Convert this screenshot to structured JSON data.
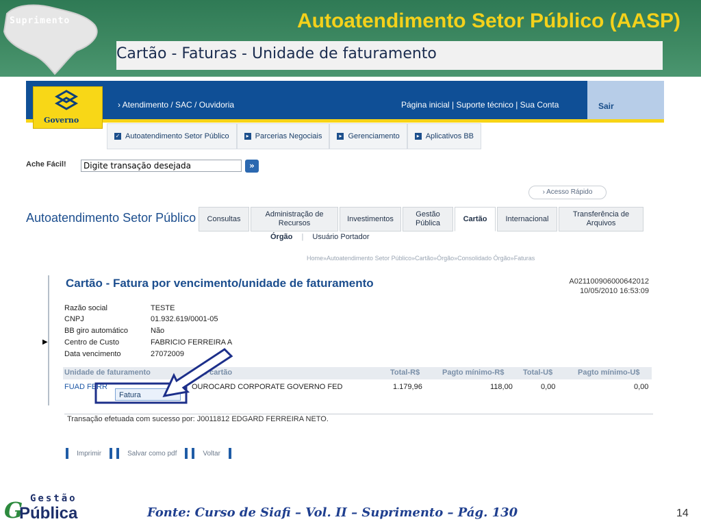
{
  "slide": {
    "title": "Autoatendimento Setor Público (AASP)",
    "subtitle": "Cartão  - Faturas - Unidade de faturamento",
    "logo_text": "Suprimento",
    "source": "Fonte: Curso de Siafi – Vol. II – Suprimento – Pág. 130",
    "page_number": "14",
    "footer_logo_small": "Gestão",
    "footer_logo_big": "Pública"
  },
  "header": {
    "bank_label": "Governo",
    "link_atendimento": "› Atendimento / SAC / Ouvidoria",
    "link_pagina_inicial": "Página inicial  |  Suporte técnico  |  Sua Conta",
    "sair": "Sair"
  },
  "nav_tabs": [
    "Autoatendimento Setor Público",
    "Parcerias Negociais",
    "Gerenciamento",
    "Aplicativos BB"
  ],
  "search": {
    "label": "Ache Fácil!",
    "value": "Digite transação desejada",
    "button": "»"
  },
  "acesso_rapido": "› Acesso Rápido",
  "aasp": {
    "title": "Autoatendimento Setor Público",
    "tabs": [
      "Consultas",
      "Administração de Recursos",
      "Investimentos",
      "Gestão Pública",
      "Cartão",
      "Internacional",
      "Transferência de Arquivos"
    ],
    "active_tab": "Cartão",
    "subtabs": [
      "Órgão",
      "Usuário Portador"
    ],
    "breadcrumb": "Home»Autoatendimento Setor Público»Cartão»Órgão»Consolidado Órgão»Faturas"
  },
  "panel": {
    "title": "Cartão - Fatura por vencimento/unidade de faturamento",
    "id": "A021100906000642012",
    "datetime": "10/05/2010 16:53:09",
    "fields": [
      {
        "label": "Razão social",
        "value": "TESTE"
      },
      {
        "label": "CNPJ",
        "value": "01.932.619/0001-05"
      },
      {
        "label": "BB giro automático",
        "value": "Não"
      },
      {
        "label": "Centro de Custo",
        "value": "FABRICIO FERREIRA A"
      },
      {
        "label": "Data vencimento",
        "value": "27072009"
      }
    ],
    "table": {
      "headers": [
        "Unidade de faturamento",
        "Tipo cartão",
        "Total-R$",
        "Pagto mínimo-R$",
        "Total-U$",
        "Pagto mínimo-U$"
      ],
      "row": [
        "FUAD FERR",
        "OUROCARD CORPORATE GOVERNO FED",
        "1.179,96",
        "118,00",
        "0,00",
        "0,00"
      ]
    },
    "popup": "Fatura"
  },
  "success_message": "Transação efetuada com sucesso por: J0011812 EDGARD FERREIRA NETO.",
  "buttons": [
    "Imprimir",
    "Salvar como pdf",
    "Voltar"
  ]
}
